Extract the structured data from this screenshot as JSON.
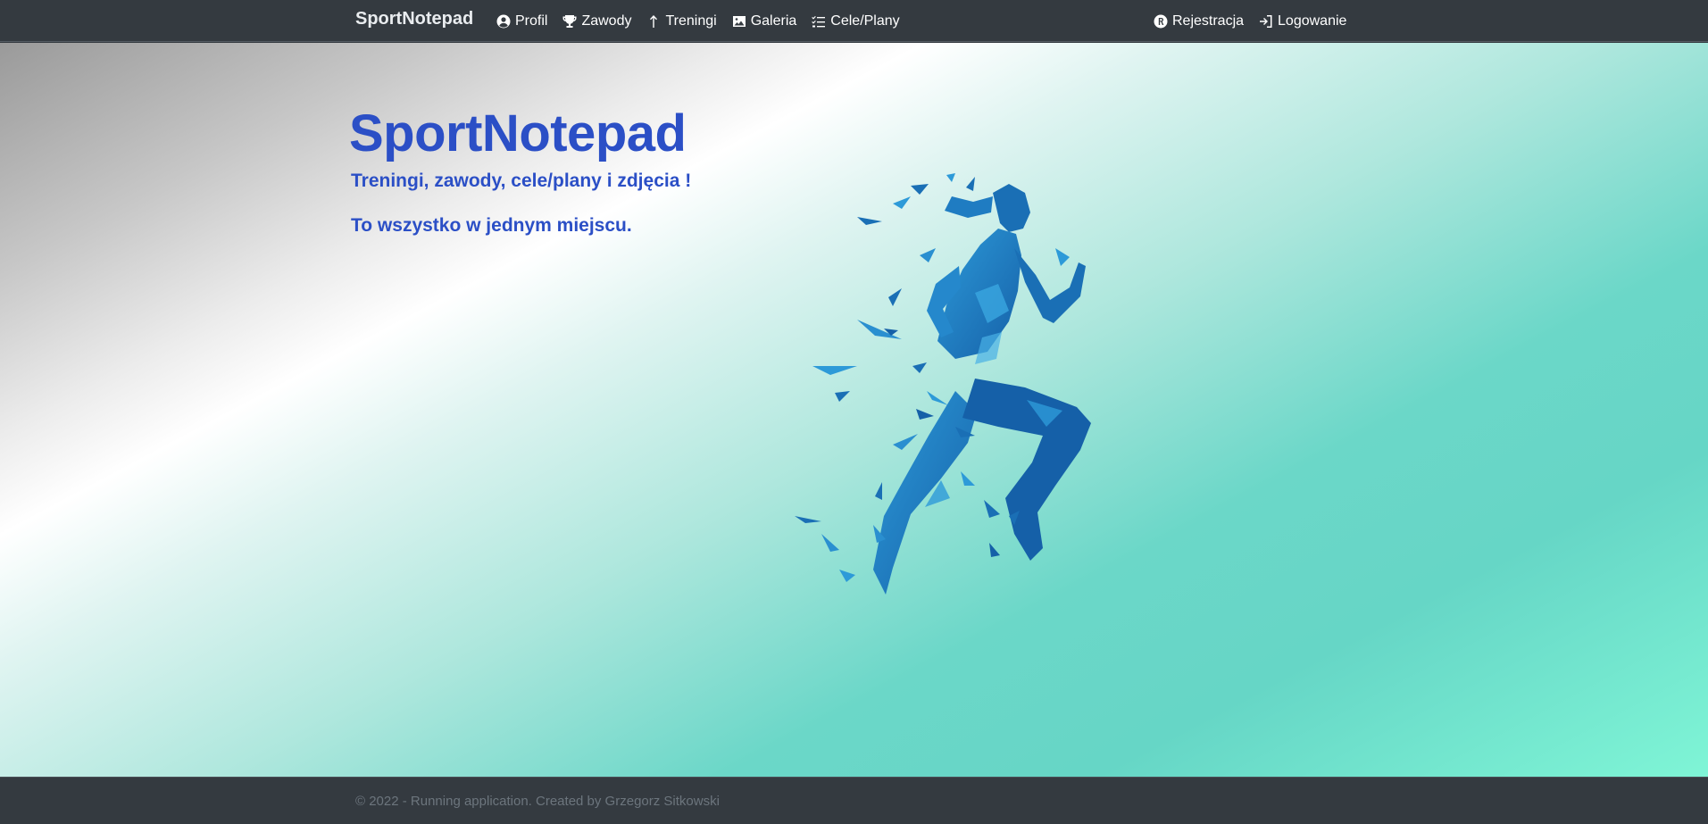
{
  "navbar": {
    "brand": "SportNotepad",
    "left_links": [
      {
        "label": "Profil",
        "icon": "user-circle-icon"
      },
      {
        "label": "Zawody",
        "icon": "trophy-icon"
      },
      {
        "label": "Treningi",
        "icon": "arrow-up-icon"
      },
      {
        "label": "Galeria",
        "icon": "image-icon"
      },
      {
        "label": "Cele/Plany",
        "icon": "checklist-icon"
      }
    ],
    "right_links": [
      {
        "label": "Rejestracja",
        "icon": "registered-icon"
      },
      {
        "label": "Logowanie",
        "icon": "login-icon"
      }
    ]
  },
  "hero": {
    "title": "SportNotepad",
    "subtitle1": "Treningi, zawody, cele/plany i zdjęcia !",
    "subtitle2": "To wszystko w jednym miejscu.",
    "image_icon": "runner-illustration",
    "colors": {
      "title": "#2b4fc6",
      "runner_dark": "#1560a8",
      "runner_light": "#2d9ad8"
    }
  },
  "footer": {
    "text": "© 2022 - Running application. Created by Grzegorz Sitkowski"
  }
}
